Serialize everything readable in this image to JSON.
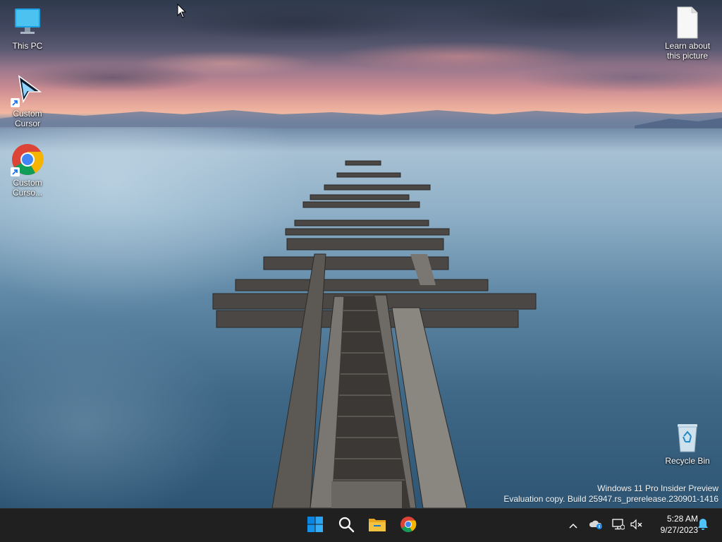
{
  "desktop": {
    "icons": [
      {
        "label": "This PC",
        "icon": "this-pc-icon"
      },
      {
        "label": "Custom Cursor",
        "icon": "custom-cursor-icon"
      },
      {
        "label": "Custom Curso...",
        "icon": "chrome-icon"
      },
      {
        "label": "Learn about this picture",
        "icon": "document-icon"
      },
      {
        "label": "Recycle Bin",
        "icon": "recycle-bin-icon"
      }
    ],
    "watermark": {
      "line1": "Windows 11 Pro Insider Preview",
      "line2": "Evaluation copy. Build 25947.rs_prerelease.230901-1416"
    }
  },
  "taskbar": {
    "apps": [
      {
        "name": "Start",
        "icon": "windows-start-icon"
      },
      {
        "name": "Search",
        "icon": "search-icon"
      },
      {
        "name": "File Explorer",
        "icon": "file-explorer-icon"
      },
      {
        "name": "Google Chrome",
        "icon": "chrome-icon"
      }
    ],
    "tray": {
      "icons": [
        "chevron-up-icon",
        "onedrive-icon",
        "network-icon",
        "volume-muted-icon"
      ],
      "time": "5:28 AM",
      "date": "9/27/2023",
      "notification_icon": "notification-bell-icon"
    }
  },
  "colors": {
    "taskbar": "#202020",
    "windows_blue": "#0078d4",
    "folder_yellow": "#f3c340"
  }
}
